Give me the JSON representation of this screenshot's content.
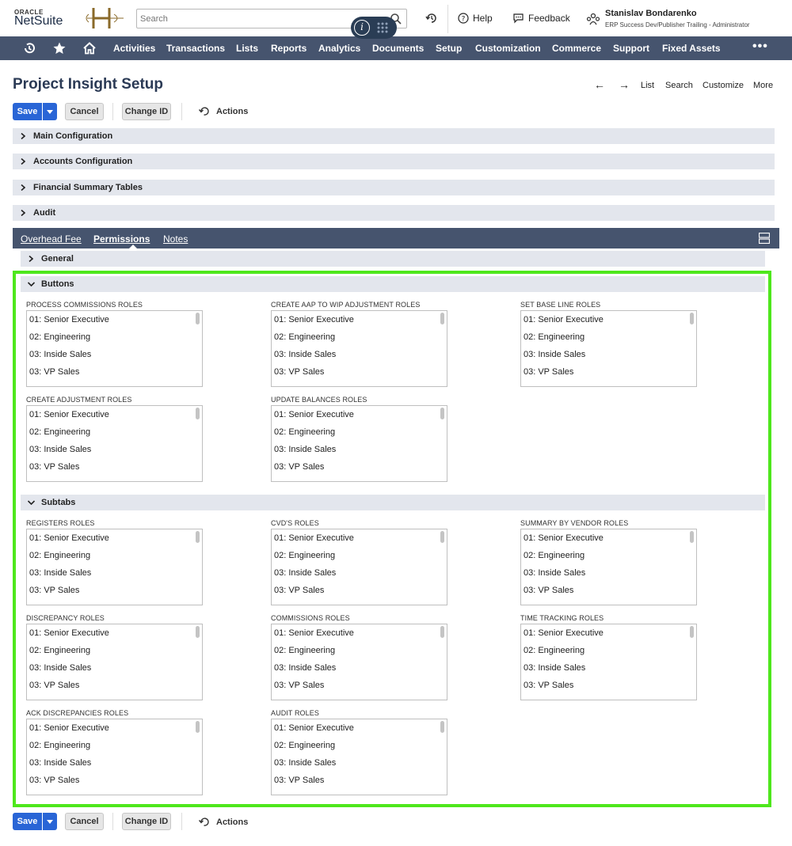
{
  "header": {
    "logo_top": "ORACLE",
    "logo_main": "NetSuite",
    "search_placeholder": "Search",
    "help_label": "Help",
    "feedback_label": "Feedback",
    "user_name": "Stanislav Bondarenko",
    "user_role": "ERP Success Dev/Publisher Trailing - Administrator"
  },
  "nav": {
    "items": [
      "Activities",
      "Transactions",
      "Lists",
      "Reports",
      "Analytics",
      "Documents",
      "Setup",
      "Customization",
      "Commerce",
      "Support",
      "Fixed Assets"
    ],
    "more": "•••"
  },
  "page": {
    "title": "Project Insight Setup",
    "tools": {
      "list": "List",
      "search": "Search",
      "customize": "Customize",
      "more": "More"
    }
  },
  "toolbar": {
    "save_label": "Save",
    "cancel_label": "Cancel",
    "change_id_label": "Change ID",
    "actions_label": "Actions"
  },
  "sections": {
    "main_configuration": "Main Configuration",
    "accounts_configuration": "Accounts Configuration",
    "financial_summary_tables": "Financial Summary Tables",
    "audit": "Audit"
  },
  "subtabs": {
    "overhead_fee": "Overhead Fee",
    "permissions": "Permissions",
    "notes": "Notes"
  },
  "subsections": {
    "general": "General",
    "buttons": "Buttons",
    "subtabs": "Subtabs"
  },
  "role_options": [
    "01: Senior Executive",
    "02: Engineering",
    "03: Inside Sales",
    "03: VP Sales"
  ],
  "fields": {
    "process_commissions": "PROCESS COMMISSIONS ROLES",
    "create_aap": "CREATE AAP TO WIP ADJUSTMENT ROLES",
    "set_base_line": "SET BASE LINE ROLES",
    "create_adjustment": "CREATE ADJUSTMENT ROLES",
    "update_balances": "UPDATE BALANCES ROLES",
    "registers": "REGISTERS ROLES",
    "cvds": "CVD'S ROLES",
    "summary_by_vendor": "SUMMARY BY VENDOR ROLES",
    "discrepancy": "DISCREPANCY ROLES",
    "commissions": "COMMISSIONS ROLES",
    "time_tracking": "TIME TRACKING ROLES",
    "ack_discrepancies": "ACK DISCREPANCIES ROLES",
    "audit_roles": "AUDIT ROLES"
  },
  "colors": {
    "nav_bg": "#46546e",
    "primary_button": "#2965d6",
    "section_bg": "#e3e6ed",
    "highlight": "#4ee71c",
    "title": "#2b3a55"
  },
  "icons": [
    "clock-icon",
    "star-icon",
    "home-icon",
    "search-icon",
    "info-icon",
    "grid-icon",
    "recent-records-icon",
    "help-icon",
    "feedback-icon",
    "user-roles-icon",
    "chevron-right-icon",
    "chevron-down-icon",
    "layout-icon"
  ]
}
